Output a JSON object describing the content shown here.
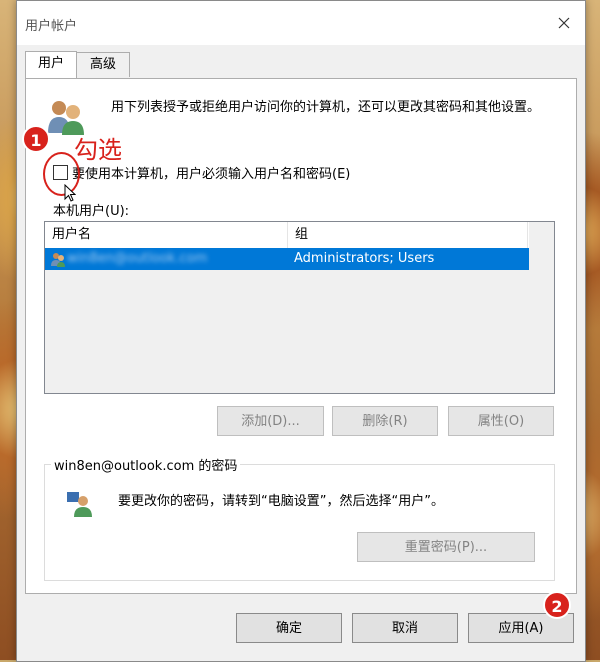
{
  "dialog": {
    "title": "用户帐户"
  },
  "tabs": [
    {
      "label": "用户",
      "active": true
    },
    {
      "label": "高级",
      "active": false
    }
  ],
  "intro_text": "用下列表授予或拒绝用户访问你的计算机，还可以更改其密码和其他设置。",
  "require_login_checkbox": {
    "label": "要使用本计算机，用户必须输入用户名和密码(E)",
    "checked": false
  },
  "annotations": {
    "step1": "1",
    "step2": "2",
    "check_hint": "勾选"
  },
  "local_users_label": "本机用户(U):",
  "users_table": {
    "columns": [
      "用户名",
      "组"
    ],
    "rows": [
      {
        "username": "win8en@outlook.com",
        "group": "Administrators; Users",
        "selected": true
      }
    ]
  },
  "buttons": {
    "add": "添加(D)...",
    "remove": "删除(R)",
    "properties": "属性(O)"
  },
  "password_group": {
    "title": "win8en@outlook.com 的密码",
    "text": "要更改你的密码，请转到“电脑设置”，然后选择“用户”。",
    "reset_button": "重置密码(P)..."
  },
  "footer": {
    "ok": "确定",
    "cancel": "取消",
    "apply": "应用(A)"
  },
  "colors": {
    "selection": "#0078d7",
    "annotation_red": "#d8221c"
  }
}
